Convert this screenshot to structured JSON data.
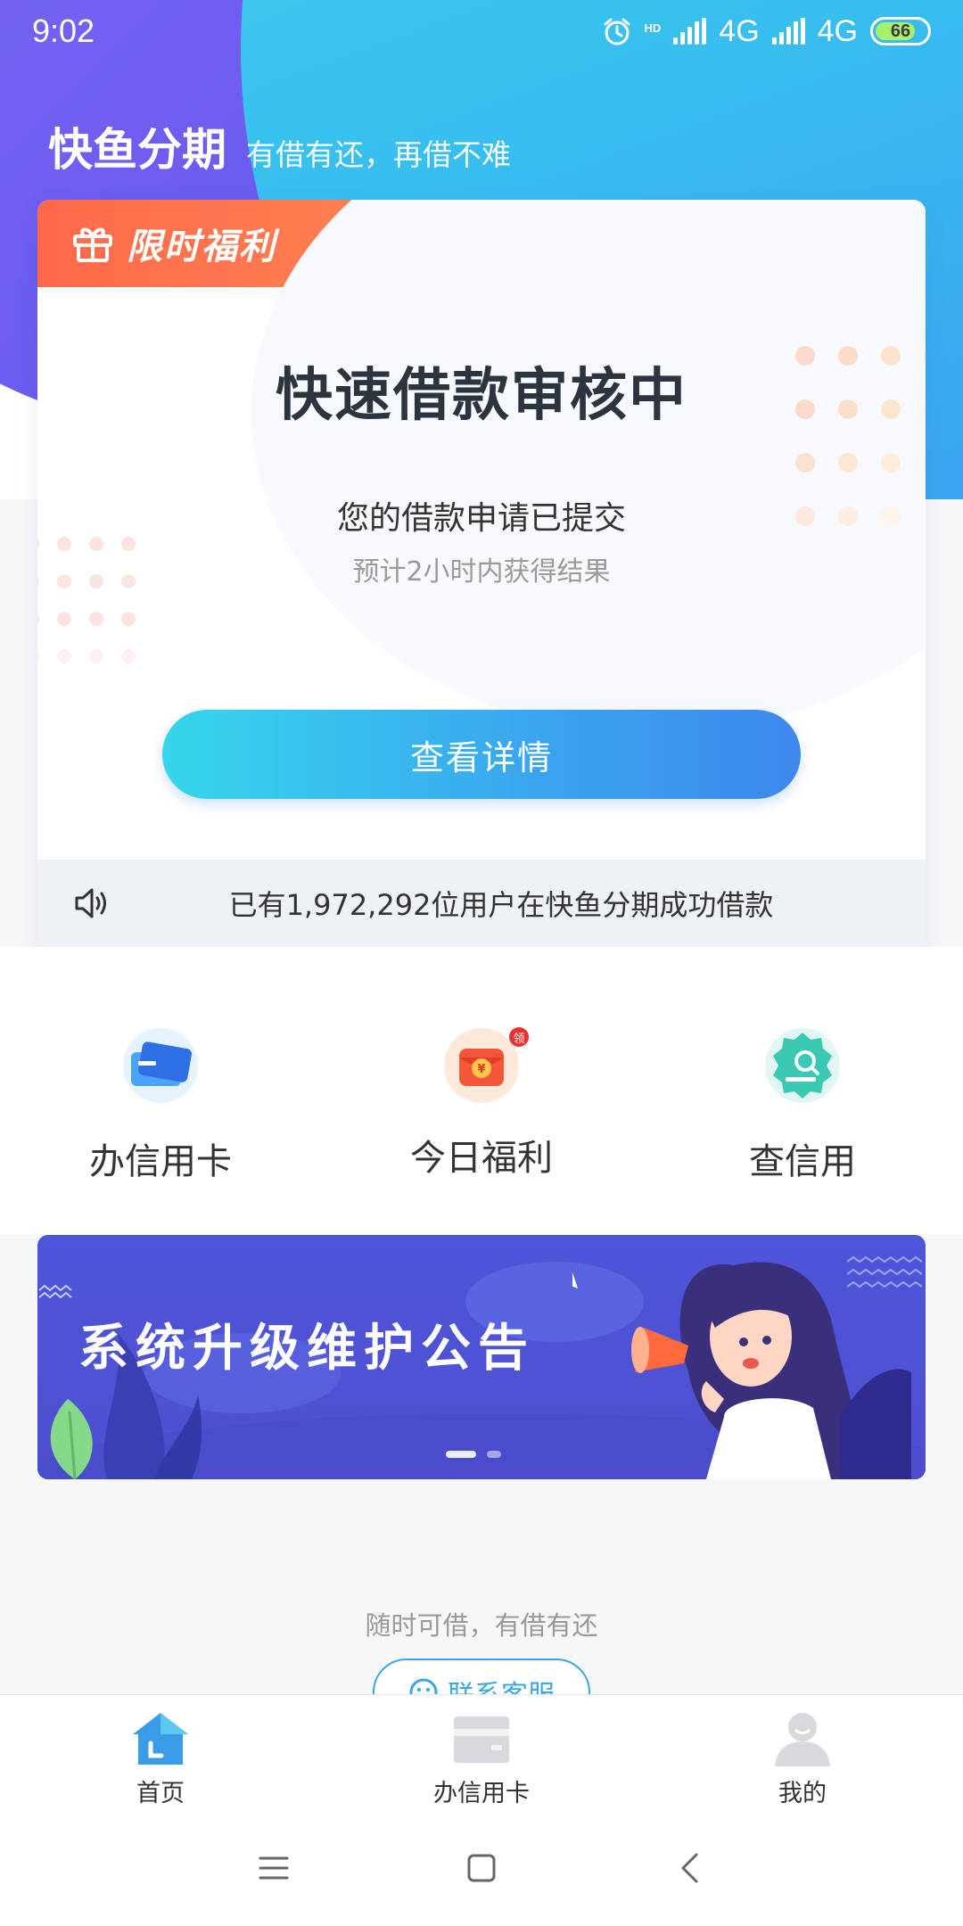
{
  "status_bar": {
    "time": "9:02",
    "network1": "4G",
    "network2": "4G",
    "battery": "66",
    "hd": "HD"
  },
  "header": {
    "app_name": "快鱼分期",
    "slogan": "有借有还，再借不难"
  },
  "card": {
    "banner_title": "限时福利",
    "status_title": "快速借款审核中",
    "subtitle": "您的借款申请已提交",
    "hint": "预计2小时内获得结果",
    "button_label": "查看详情",
    "notice": "已有1,972,292位用户在快鱼分期成功借款"
  },
  "quick_actions": [
    {
      "label": "办信用卡",
      "icon": "credit-card-icon"
    },
    {
      "label": "今日福利",
      "icon": "red-envelope-icon",
      "badge": "领"
    },
    {
      "label": "查信用",
      "icon": "credit-search-icon"
    }
  ],
  "promo": {
    "title": "系统升级维护公告",
    "slides": 2,
    "active_slide": 1
  },
  "footer": {
    "tagline": "随时可借，有借有还",
    "contact_label": "联系客服"
  },
  "tabs": [
    {
      "label": "首页",
      "icon": "home-icon",
      "active": true
    },
    {
      "label": "办信用卡",
      "icon": "card-icon",
      "active": false
    },
    {
      "label": "我的",
      "icon": "profile-icon",
      "active": false
    }
  ],
  "colors": {
    "primary": "#3a9be9",
    "accent_orange": "#ff6a4a",
    "promo_bg": "#4d55d8"
  }
}
